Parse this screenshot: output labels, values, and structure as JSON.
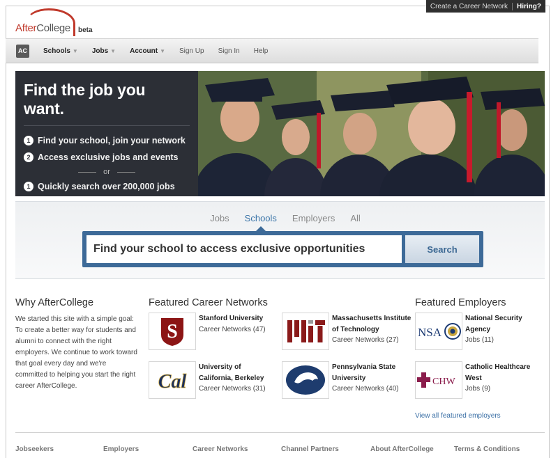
{
  "header": {
    "create_network": "Create a Career Network",
    "hiring": "Hiring?",
    "logo_after": "After",
    "logo_college": "College",
    "beta": "beta"
  },
  "nav": {
    "ac": "AC",
    "schools": "Schools",
    "jobs": "Jobs",
    "account": "Account",
    "signup": "Sign Up",
    "signin": "Sign In",
    "help": "Help"
  },
  "hero": {
    "title": "Find the job you want.",
    "step1_num": "1",
    "step1": "Find your school, join your network",
    "step2_num": "2",
    "step2": "Access exclusive jobs and events",
    "or": "or",
    "step3_num": "1",
    "step3": "Quickly search over 200,000 jobs"
  },
  "search": {
    "tabs": [
      "Jobs",
      "Schools",
      "Employers",
      "All"
    ],
    "placeholder": "Find your school to access exclusive opportunities",
    "button": "Search"
  },
  "why": {
    "title": "Why AfterCollege",
    "text": "We started this site with a simple goal: To create a better way for students and alumni to connect with the right employers. We continue to work toward that goal every day and we're committed to helping you start the right career AfterCollege."
  },
  "networks": {
    "title": "Featured Career Networks",
    "items": [
      {
        "name": "Stanford University",
        "sub": "Career Networks (47)"
      },
      {
        "name": "Massachusetts Institute of Technology",
        "sub": "Career Networks (27)"
      },
      {
        "name": "University of California, Berkeley",
        "sub": "Career Networks (31)"
      },
      {
        "name": "Pennsylvania State University",
        "sub": "Career Networks (40)"
      }
    ],
    "logos": {
      "stanford": "S",
      "mit": "MIT",
      "cal": "Cal"
    }
  },
  "employers": {
    "title": "Featured Employers",
    "items": [
      {
        "name": "National Security Agency",
        "sub": "Jobs (11)"
      },
      {
        "name": "Catholic Healthcare West",
        "sub": "Jobs (9)"
      }
    ],
    "logos": {
      "nsa": "NSA",
      "chw": "CHW"
    },
    "view_all": "View all featured employers"
  },
  "footer": [
    "Jobseekers",
    "Employers",
    "Career Networks",
    "Channel Partners",
    "About AfterCollege",
    "Terms & Conditions"
  ],
  "colors": {
    "brand_red": "#c0392b",
    "accent_blue": "#3d6a98",
    "hero_dark": "#2c2f36"
  }
}
